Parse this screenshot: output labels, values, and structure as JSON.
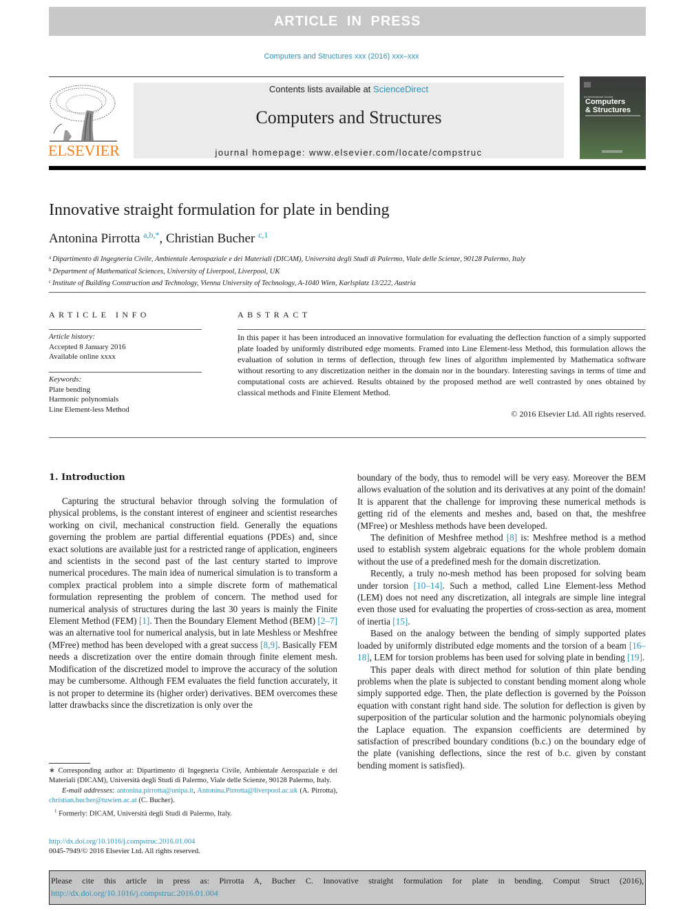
{
  "banner": {
    "text": "ARTICLE IN PRESS"
  },
  "journal_ref": "Computers and Structures xxx (2016) xxx–xxx",
  "masthead": {
    "contents_prefix": "Contents lists available at ",
    "contents_link": "ScienceDirect",
    "journal_name": "Computers and Structures",
    "homepage_label": "journal homepage: ",
    "homepage_url": "www.elsevier.com/locate/compstruc"
  },
  "publisher_logo": {
    "wordmark": "ELSEVIER",
    "icon": "elsevier-tree-icon",
    "color": "#f07d1a"
  },
  "cover": {
    "line1": "Computers",
    "line2": "& Structures",
    "top_text": "An International Journal"
  },
  "article": {
    "title": "Innovative straight formulation for plate in bending",
    "authors": [
      {
        "name": "Antonina Pirrotta",
        "marks": "a,b,*"
      },
      {
        "name": "Christian Bucher",
        "marks": "c,1"
      }
    ],
    "author_separator": ", ",
    "affiliations": [
      {
        "mark": "a",
        "text": "Dipartimento di Ingegneria Civile, Ambientale Aerospaziale e dei Materiali (DICAM), Università degli Studi di Palermo, Viale delle Scienze, 90128 Palermo, Italy"
      },
      {
        "mark": "b",
        "text": "Department of Mathematical Sciences, University of Liverpool, Liverpool, UK"
      },
      {
        "mark": "c",
        "text": "Institute of Building Construction and Technology, Vienna University of Technology, A-1040 Wien, Karlsplatz 13/222, Austria"
      }
    ]
  },
  "article_info": {
    "heading": "ARTICLE INFO",
    "history_label": "Article history:",
    "history": [
      "Accepted 8 January 2016",
      "Available online xxxx"
    ],
    "keywords_label": "Keywords:",
    "keywords": [
      "Plate bending",
      "Harmonic polynomials",
      "Line Element-less Method"
    ]
  },
  "abstract": {
    "heading": "ABSTRACT",
    "text": "In this paper it has been introduced an innovative formulation for evaluating the deflection function of a simply supported plate loaded by uniformly distributed edge moments. Framed into Line Element-less Method, this formulation allows the evaluation of solution in terms of deflection, through few lines of algorithm implemented by Mathematica software without resorting to any discretization neither in the domain nor in the boundary. Interesting savings in terms of time and computational costs are achieved. Results obtained by the proposed method are well contrasted by ones obtained by classical methods and Finite Element Method.",
    "copyright": "© 2016 Elsevier Ltd. All rights reserved."
  },
  "body": {
    "section_heading": "1. Introduction",
    "left_paragraph": {
      "parts": [
        {
          "t": "Capturing the structural behavior through solving the formulation of physical problems, is the constant interest of engineer and scientist researches working on civil, mechanical construction field. Generally the equations governing the problem are partial differential equations (PDEs) and, since exact solutions are available just for a restricted range of application, engineers and scientists in the second past of the last century started to improve numerical procedures. The main idea of numerical simulation is to transform a complex practical problem into a simple discrete form of mathematical formulation representing the problem of concern. The method used for numerical analysis of structures during the last 30 years is mainly the Finite Element Method (FEM) "
        },
        {
          "ref": "[1]"
        },
        {
          "t": ". Then the Boundary Element Method (BEM) "
        },
        {
          "ref": "[2–7]"
        },
        {
          "t": " was an alternative tool for numerical analysis, but in late Meshless or Meshfree (MFree) method has been developed with a great success "
        },
        {
          "ref": "[8,9]"
        },
        {
          "t": ". Basically FEM needs a discretization over the entire domain through finite element mesh. Modification of the discretized model to improve the accuracy of the solution may be cumbersome. Although FEM evaluates the field function accurately, it is not proper to determine its (higher order) derivatives. BEM overcomes these latter drawbacks since the discretization is only over the"
        }
      ]
    },
    "right_paragraphs": [
      {
        "indent": false,
        "parts": [
          {
            "t": "boundary of the body, thus to remodel will be very easy. Moreover the BEM allows evaluation of the solution and its derivatives at any point of the domain! It is apparent that the challenge for improving these numerical methods is getting rid of the elements and meshes and, based on that, the meshfree (MFree) or Meshless methods have been developed."
          }
        ]
      },
      {
        "indent": true,
        "parts": [
          {
            "t": "The definition of Meshfree method "
          },
          {
            "ref": "[8]"
          },
          {
            "t": " is: Meshfree method is a method used to establish system algebraic equations for the whole problem domain without the use of a predefined mesh for the domain discretization."
          }
        ]
      },
      {
        "indent": true,
        "parts": [
          {
            "t": "Recently, a truly no-mesh method has been proposed for solving beam under torsion "
          },
          {
            "ref": "[10–14]"
          },
          {
            "t": ". Such a method, called Line Element-less Method (LEM) does not need any discretization, all integrals are simple line integral even those used for evaluating the properties of cross-section as area, moment of inertia "
          },
          {
            "ref": "[15]"
          },
          {
            "t": "."
          }
        ]
      },
      {
        "indent": true,
        "parts": [
          {
            "t": "Based on the analogy between the bending of simply supported plates loaded by uniformly distributed edge moments and the torsion of a beam "
          },
          {
            "ref": "[16–18]"
          },
          {
            "t": ", LEM for torsion problems has been used for solving plate in bending "
          },
          {
            "ref": "[19]"
          },
          {
            "t": "."
          }
        ]
      },
      {
        "indent": true,
        "parts": [
          {
            "t": "This paper deals with direct method for solution of thin plate bending problems when the plate is subjected to constant bending moment along whole simply supported edge. Then, the plate deflection is governed by the Poisson equation with constant right hand side. The solution for deflection is given by superposition of the particular solution and the harmonic polynomials obeying the Laplace equation. The expansion coefficients are determined by satisfaction of prescribed boundary conditions (b.c.) on the boundary edge of the plate (vanishing deflections, since the rest of b.c. given by constant bending moment is satisfied)."
          }
        ]
      }
    ]
  },
  "footnotes": {
    "corresponding": "∗ Corresponding author at: Dipartimento di Ingegneria Civile, Ambientale Aerospaziale e dei Materiali (DICAM), Università degli Studi di Palermo, Viale delle Scienze, 90128 Palermo, Italy.",
    "email_label": "E-mail addresses:",
    "email1": "antonina.pirrotta@unipa.it",
    "email2": "Antonina.Pirrotta@liverpool.ac.uk",
    "email_owner1": "(A. Pirrotta),",
    "email3": "christian.bucher@tuwien.ac.at",
    "email_owner2": "(C. Bucher).",
    "note1_mark": "1",
    "note1": "Formerly: DICAM, Università degli Studi di Palermo, Italy.",
    "doi": "http://dx.doi.org/10.1016/j.compstruc.2016.01.004",
    "issn_line": "0045-7949/© 2016 Elsevier Ltd. All rights reserved."
  },
  "cite_box": {
    "text": "Please cite this article in press as: Pirrotta A, Bucher C. Innovative straight formulation for plate in bending. Comput Struct (2016), ",
    "link": "http://dx.doi.org/10.1016/j.compstruc.2016.01.004"
  }
}
